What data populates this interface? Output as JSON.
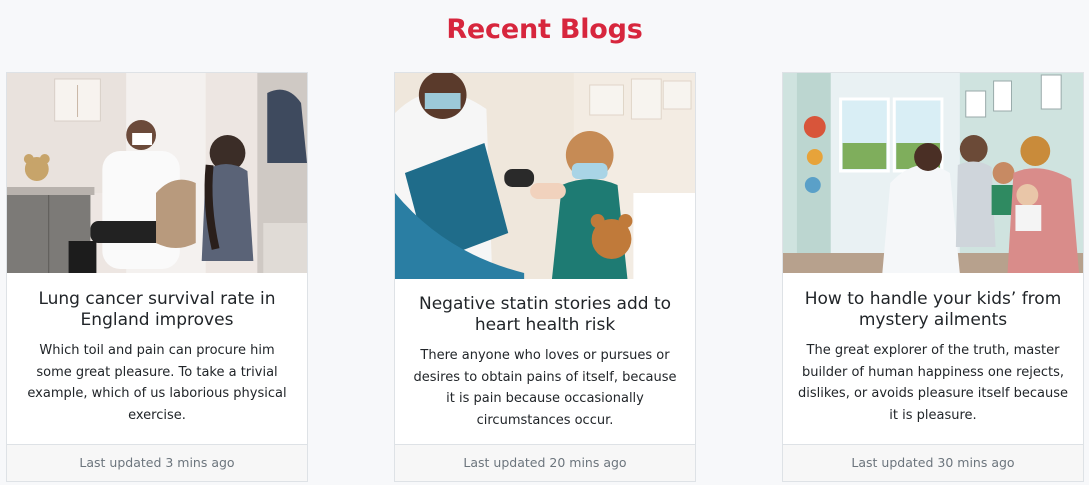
{
  "section": {
    "title": "Recent Blogs"
  },
  "colors": {
    "title": "#d7263d",
    "page_background": "#f7f8fa",
    "card_footer_background": "#f7f7f7",
    "muted_text": "#6c757d"
  },
  "blogs": [
    {
      "image": "photo-doctor-examining-girl",
      "title": "Lung cancer survival rate in England improves",
      "excerpt": "Which toil and pain can procure him some great pleasure. To take a trivial example, which of us laborious physical exercise.",
      "footer": "Last updated 3 mins ago"
    },
    {
      "image": "photo-nurse-and-child-elbow-bump",
      "title": "Negative statin stories add to heart health risk",
      "excerpt": "There anyone who loves or pursues or desires to obtain pains of itself, because it is pain because occasionally circumstances occur.",
      "footer": "Last updated 20 mins ago"
    },
    {
      "image": "photo-doctor-with-family",
      "title": "How to handle your kids’ from mystery ailments",
      "excerpt": "The great explorer of the truth, master builder of human happiness one rejects, dislikes, or avoids pleasure itself because it is pleasure.",
      "footer": "Last updated 30 mins ago"
    }
  ]
}
